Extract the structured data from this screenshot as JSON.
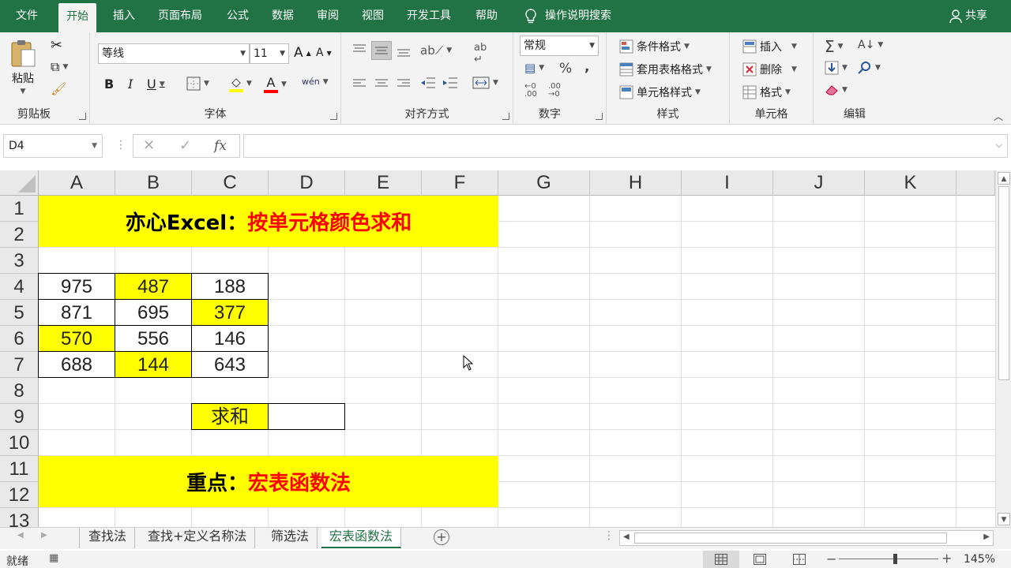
{
  "menu": {
    "tabs": [
      "文件",
      "开始",
      "插入",
      "页面布局",
      "公式",
      "数据",
      "审阅",
      "视图",
      "开发工具",
      "帮助"
    ],
    "active_tab": "开始",
    "search_label": "操作说明搜索",
    "share_label": "共享"
  },
  "ribbon": {
    "clipboard": {
      "paste_label": "粘贴",
      "group_label": "剪贴板"
    },
    "font": {
      "name": "等线",
      "size": "11",
      "group_label": "字体",
      "bold": "B",
      "italic": "I",
      "underline": "U",
      "grow": "A",
      "shrink": "A",
      "font_color": "A",
      "phonetic": "wén"
    },
    "alignment": {
      "group_label": "对齐方式"
    },
    "number": {
      "format": "常规",
      "group_label": "数字",
      "percent": "%",
      "comma": ","
    },
    "styles": {
      "conditional": "条件格式",
      "table": "套用表格格式",
      "cell": "单元格样式",
      "group_label": "样式"
    },
    "cells": {
      "insert": "插入",
      "delete": "删除",
      "format": "格式",
      "group_label": "单元格"
    },
    "editing": {
      "group_label": "编辑"
    }
  },
  "formula_bar": {
    "name_box": "D4",
    "fx": "fx",
    "value": ""
  },
  "grid": {
    "columns": [
      "A",
      "B",
      "C",
      "D",
      "E",
      "F",
      "G",
      "H",
      "I",
      "J",
      "K"
    ],
    "rows": [
      "1",
      "2",
      "3",
      "4",
      "5",
      "6",
      "7",
      "8",
      "9",
      "10",
      "11",
      "12",
      "13"
    ],
    "title_black": "亦心Excel：",
    "title_red": "按单元格颜色求和",
    "data": [
      [
        "975",
        "487",
        "188"
      ],
      [
        "871",
        "695",
        "377"
      ],
      [
        "570",
        "556",
        "146"
      ],
      [
        "688",
        "144",
        "643"
      ]
    ],
    "sum_label": "求和",
    "sum_value": "",
    "note_black": "重点：",
    "note_red": "宏表函数法",
    "highlight_color": "#ffff00",
    "red_color": "#ff0000"
  },
  "sheets": {
    "tabs": [
      "查找法",
      "查找+定义名称法",
      "筛选法",
      "宏表函数法"
    ],
    "active": "宏表函数法"
  },
  "status": {
    "ready": "就绪",
    "zoom": "145%"
  },
  "theme": {
    "excel_green": "#217346"
  }
}
